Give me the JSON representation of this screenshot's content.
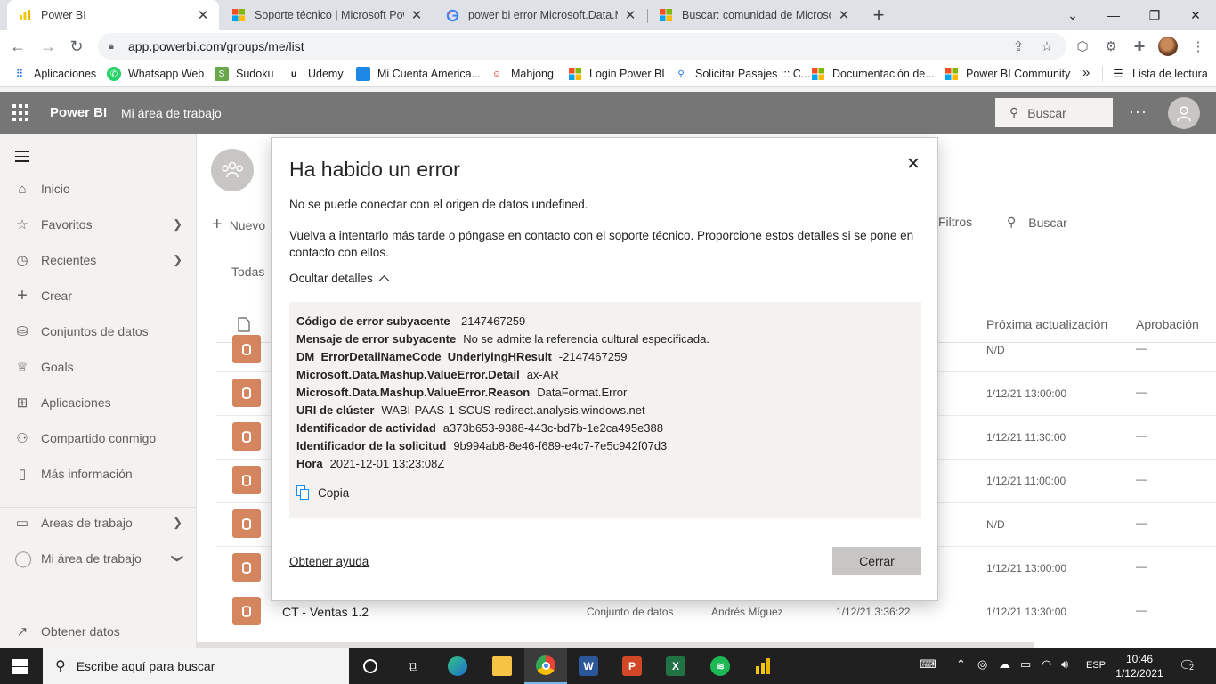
{
  "browser": {
    "tabs": [
      {
        "title": "Power BI",
        "active": true
      },
      {
        "title": "Soporte técnico | Microsoft Powe",
        "active": false
      },
      {
        "title": "power bi error Microsoft.Data.M",
        "active": false
      },
      {
        "title": "Buscar: comunidad de Microsoft",
        "active": false
      }
    ],
    "new_tab": "+",
    "url": "app.powerbi.com/groups/me/list",
    "bookmarks": [
      "Aplicaciones",
      "Whatsapp Web",
      "Sudoku",
      "Udemy",
      "Mi Cuenta America...",
      "Mahjong",
      "Login Power BI",
      "Solicitar Pasajes ::: C...",
      "Documentación de...",
      "Power BI Community"
    ],
    "bookmarks_overflow": "»",
    "reading_list": "Lista de lectura"
  },
  "pbi": {
    "brand": "Power BI",
    "workspace": "Mi área de trabajo",
    "search_placeholder": "Buscar",
    "more": "···"
  },
  "nav": {
    "items": [
      {
        "label": "Inicio",
        "icon": "home-icon",
        "glyph": "⌂"
      },
      {
        "label": "Favoritos",
        "icon": "star-icon",
        "glyph": "☆",
        "chevron": true
      },
      {
        "label": "Recientes",
        "icon": "clock-icon",
        "glyph": "◷",
        "chevron": true
      },
      {
        "label": "Crear",
        "icon": "plus-icon",
        "glyph": "+"
      },
      {
        "label": "Conjuntos de datos",
        "icon": "database-icon",
        "glyph": "⛁"
      },
      {
        "label": "Goals",
        "icon": "trophy-icon",
        "glyph": "♕"
      },
      {
        "label": "Aplicaciones",
        "icon": "apps-icon",
        "glyph": "⊞"
      },
      {
        "label": "Compartido conmigo",
        "icon": "share-icon",
        "glyph": "⚇"
      },
      {
        "label": "Más información",
        "icon": "book-icon",
        "glyph": "▯"
      },
      {
        "label": "Áreas de trabajo",
        "icon": "workspaces-icon",
        "glyph": "▭",
        "chevron": true
      },
      {
        "label": "Mi área de trabajo",
        "icon": "user-icon",
        "glyph": "◯",
        "chevron": true
      },
      {
        "label": "Obtener datos",
        "icon": "arrow-icon",
        "glyph": "↗"
      }
    ]
  },
  "content": {
    "new_label": "Nuevo",
    "filters_label": "Filtros",
    "search_label": "Buscar",
    "all_label": "Todas",
    "col_next_refresh": "Próxima actualización",
    "col_approval": "Aprobación",
    "rows": [
      {
        "next": "N/D",
        "approval": "—"
      },
      {
        "next": "1/12/21 13:00:00",
        "approval": "—"
      },
      {
        "next": "1/12/21 11:30:00",
        "approval": "—"
      },
      {
        "next": "1/12/21 11:00:00",
        "approval": "—"
      },
      {
        "next": "N/D",
        "approval": "—"
      },
      {
        "next": "1/12/21 13:00:00",
        "approval": "—"
      },
      {
        "name": "CT - Ventas 1.2",
        "type": "Conjunto de datos",
        "owner": "Andrés Míguez",
        "refreshed": "1/12/21 3:36:22",
        "next": "1/12/21 13:30:00",
        "approval": "—"
      }
    ]
  },
  "dialog": {
    "title": "Ha habido un error",
    "message": "No se puede conectar con el origen de datos undefined.",
    "retry": "Vuelva a intentarlo más tarde o póngase en contacto con el soporte técnico. Proporcione estos detalles si se pone en contacto con ellos.",
    "toggle": "Ocultar detalles",
    "details": [
      {
        "key": "Código de error subyacente",
        "value": "-2147467259"
      },
      {
        "key": "Mensaje de error subyacente",
        "value": "No se admite la referencia cultural especificada."
      },
      {
        "key": "DM_ErrorDetailNameCode_UnderlyingHResult",
        "value": "-2147467259"
      },
      {
        "key": "Microsoft.Data.Mashup.ValueError.Detail",
        "value": "ax-AR"
      },
      {
        "key": "Microsoft.Data.Mashup.ValueError.Reason",
        "value": "DataFormat.Error"
      },
      {
        "key": "URI de clúster",
        "value": "WABI-PAAS-1-SCUS-redirect.analysis.windows.net"
      },
      {
        "key": "Identificador de actividad",
        "value": "a373b653-9388-443c-bd7b-1e2ca495e388"
      },
      {
        "key": "Identificador de la solicitud",
        "value": "9b994ab8-8e46-f689-e4c7-7e5c942f07d3"
      },
      {
        "key": "Hora",
        "value": "2021-12-01 13:23:08Z"
      }
    ],
    "copy": "Copia",
    "help": "Obtener ayuda",
    "close": "Cerrar"
  },
  "taskbar": {
    "search_placeholder": "Escribe aquí para buscar",
    "lang": "ESP",
    "time": "10:46",
    "date": "1/12/2021",
    "notifications": "2"
  },
  "colors": {
    "pbi_header": "#767676",
    "dataset_icon": "#d6865f",
    "accent_blue": "#118dff"
  }
}
